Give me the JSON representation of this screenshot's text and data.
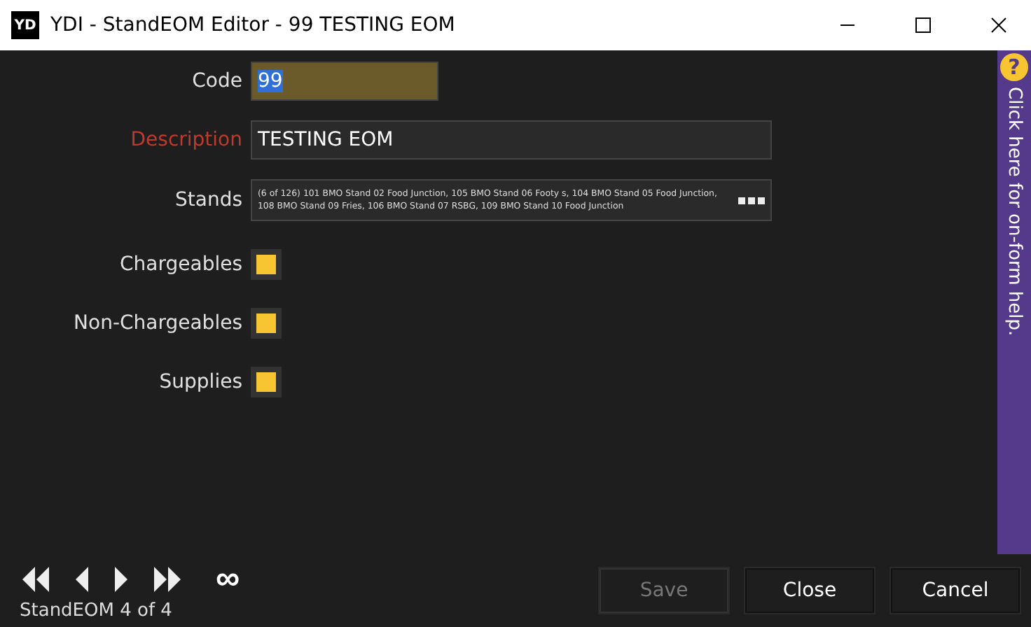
{
  "window": {
    "title": "YDI - StandEOM Editor - 99 TESTING EOM",
    "logo": "YD"
  },
  "fields": [
    {
      "kind": "code",
      "label": "Code",
      "value": "99",
      "required": false
    },
    {
      "kind": "text",
      "label": "Description",
      "value": "TESTING EOM",
      "required": true
    },
    {
      "kind": "picker",
      "label": "Stands",
      "required": false,
      "value": "(6 of 126) 101 BMO Stand 02 Food Junction, 105 BMO Stand 06 Footy s, 104 BMO Stand 05 Food Junction, 108 BMO Stand 09 Fries, 106 BMO Stand 07 RSBG, 109 BMO Stand 10 Food Junction"
    }
  ],
  "checkboxes": [
    {
      "label": "Chargeables",
      "checked": true
    },
    {
      "label": "Non-Chargeables",
      "checked": true
    },
    {
      "label": "Supplies",
      "checked": true
    }
  ],
  "help": {
    "icon": "?",
    "text": "Click here for on-form help."
  },
  "navigation": {
    "loop": "∞",
    "status": "StandEOM 4 of 4"
  },
  "buttons": [
    {
      "label": "Save",
      "disabled": true
    },
    {
      "label": "Close",
      "disabled": false
    },
    {
      "label": "Cancel",
      "disabled": false
    }
  ]
}
